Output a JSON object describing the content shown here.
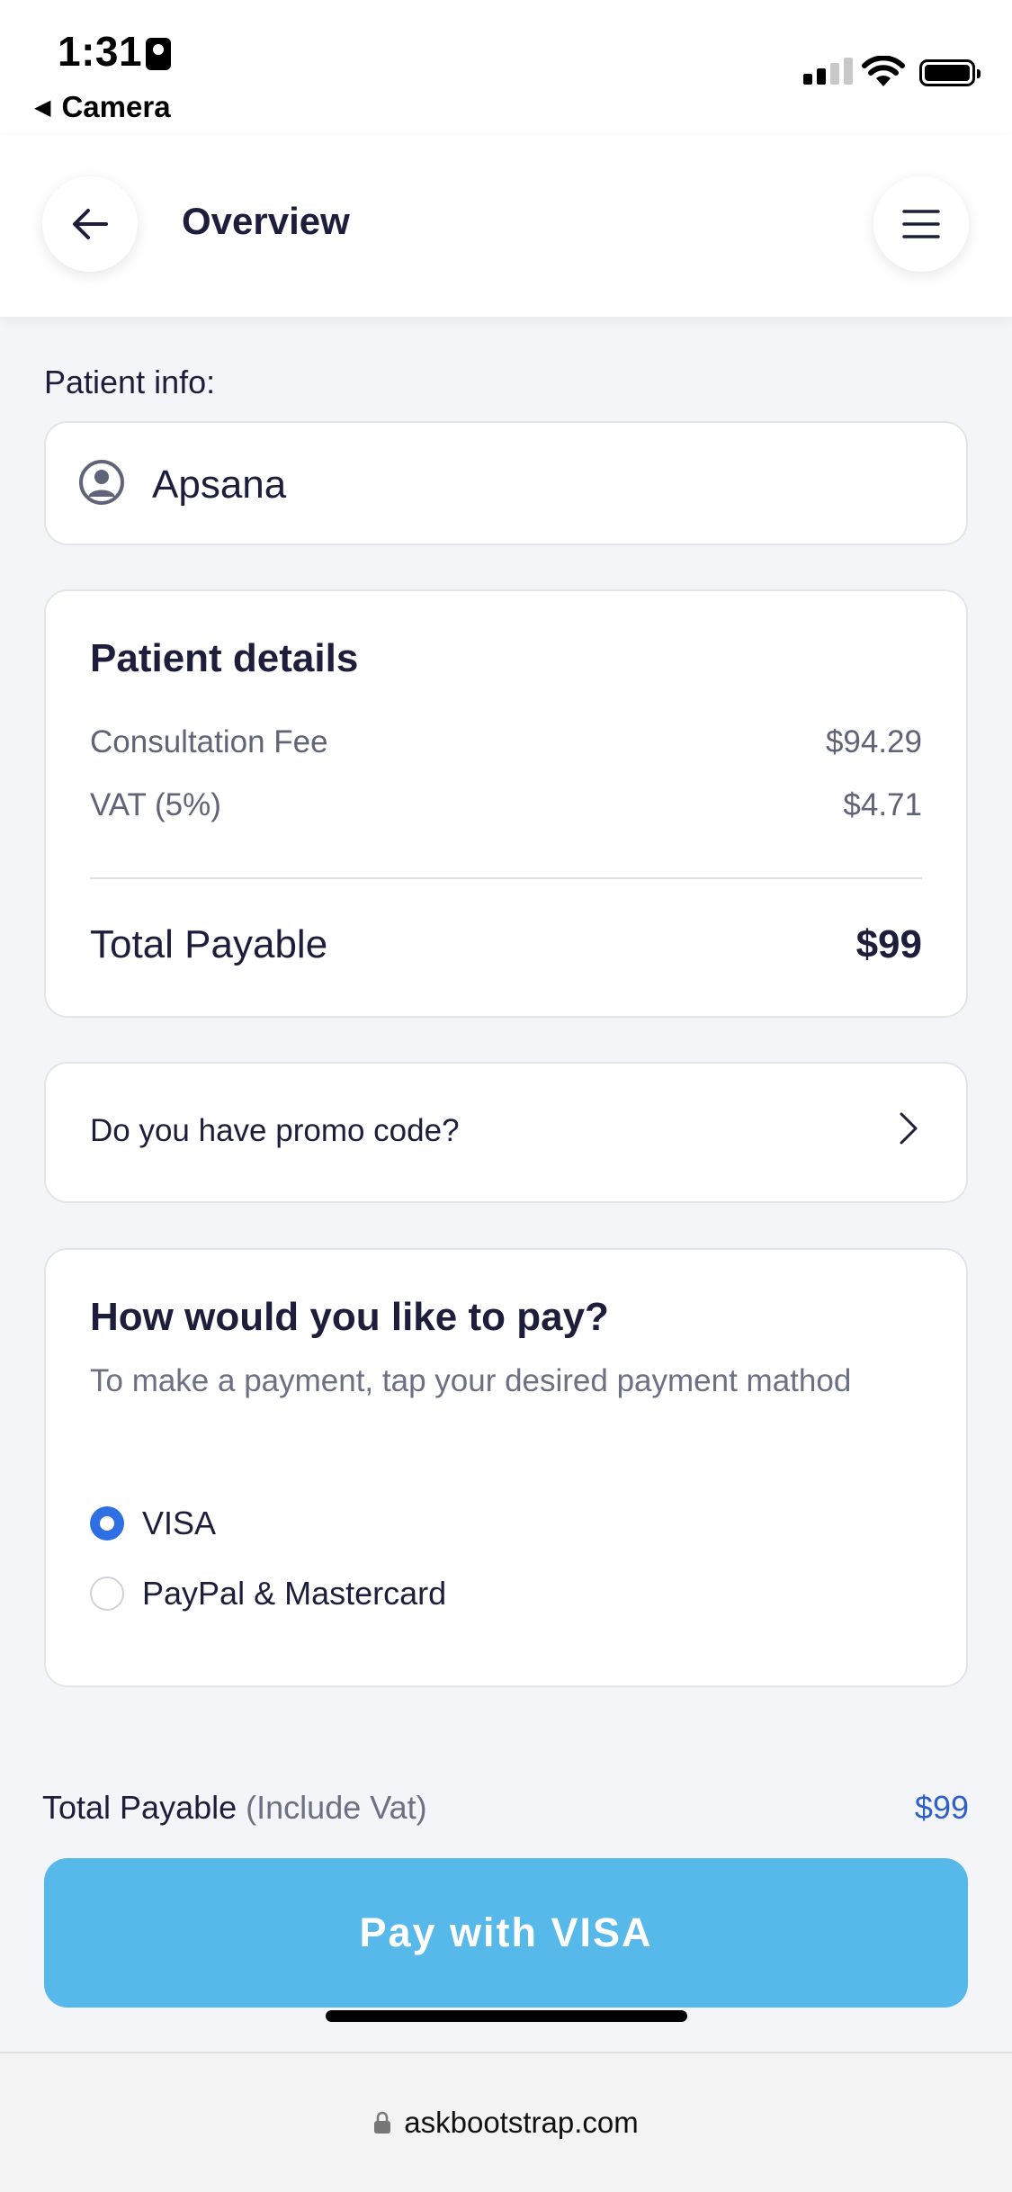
{
  "status_bar": {
    "time": "1:31",
    "back_app": "Camera"
  },
  "header": {
    "title": "Overview",
    "back_icon": "arrow-left-icon",
    "menu_icon": "hamburger-menu-icon"
  },
  "patient": {
    "section_label": "Patient info:",
    "name": "Apsana",
    "icon": "user-circle-icon"
  },
  "details": {
    "title": "Patient details",
    "fee_label": "Consultation Fee",
    "fee_value": "$94.29",
    "vat_label": "VAT (5%)",
    "vat_value": "$4.71",
    "total_label": "Total Payable",
    "total_value": "$99"
  },
  "promo": {
    "label": "Do you have promo code?",
    "icon": "chevron-right-icon"
  },
  "payment": {
    "title": "How would you like to pay?",
    "subtitle": "To make a payment, tap your desired payment mathod",
    "options": [
      {
        "label": "VISA",
        "selected": true
      },
      {
        "label": "PayPal & Mastercard",
        "selected": false
      }
    ]
  },
  "summary": {
    "label": "Total Payable",
    "note": "(Include Vat)",
    "value": "$99"
  },
  "pay_button": {
    "label": "Pay with VISA",
    "color": "#56b9ea"
  },
  "browser": {
    "url": "askbootstrap.com"
  },
  "colors": {
    "accent": "#2f6fe4",
    "price_link": "#2f5fc8",
    "text": "#1d1e3c",
    "muted": "#6b7083"
  }
}
